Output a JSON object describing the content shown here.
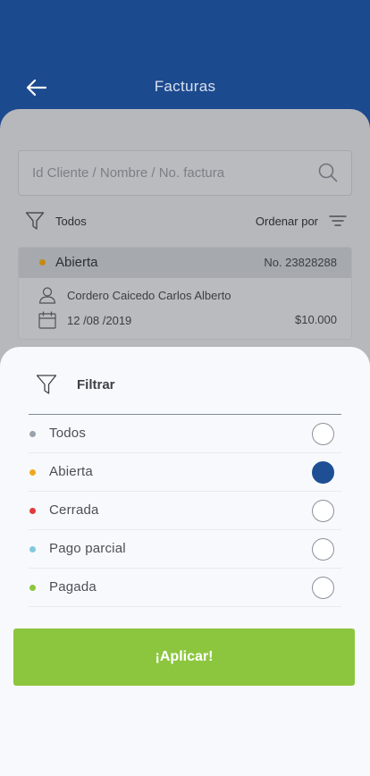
{
  "header": {
    "title": "Facturas"
  },
  "search": {
    "placeholder": "Id Cliente / Nombre / No. factura"
  },
  "filter_bar": {
    "filter_label": "Todos",
    "sort_label": "Ordenar por"
  },
  "invoice": {
    "status": "Abierta",
    "number": "No. 23828288",
    "client": "Cordero Caicedo Carlos Alberto",
    "date": "12 /08 /2019",
    "amount": "$10.000",
    "status_color": "#c58a10"
  },
  "sheet": {
    "title": "Filtrar",
    "options": [
      {
        "label": "Todos",
        "color": "#9aa3ab",
        "selected": false
      },
      {
        "label": "Abierta",
        "color": "#f2a81d",
        "selected": true
      },
      {
        "label": "Cerrada",
        "color": "#e03a3a",
        "selected": false
      },
      {
        "label": "Pago parcial",
        "color": "#7fc8e0",
        "selected": false
      },
      {
        "label": "Pagada",
        "color": "#8cc63f",
        "selected": false
      }
    ],
    "apply_label": "¡Aplicar!"
  },
  "colors": {
    "primary": "#1c4a8e",
    "accent_green": "#8cc63f",
    "radio_selected": "#1e4f95"
  },
  "icons": [
    "arrow-left-icon",
    "search-icon",
    "funnel-icon",
    "sort-lines-icon",
    "user-icon",
    "calendar-icon"
  ]
}
